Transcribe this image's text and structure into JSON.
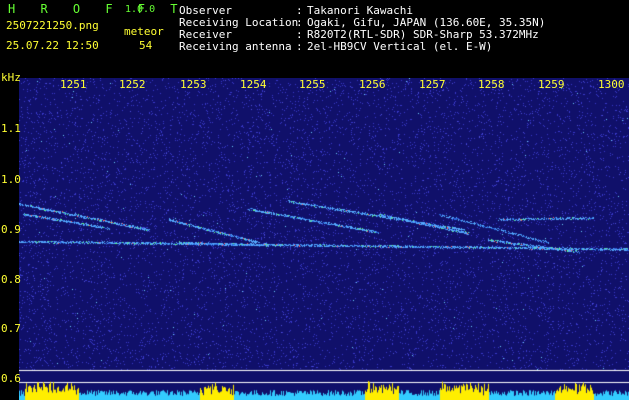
{
  "header": {
    "app_title": "H R O F F T",
    "version": "1.0.0",
    "filename": "2507221250.png",
    "datetime": "25.07.22 12:50",
    "count_label": "meteor",
    "count_value": "54",
    "fields": [
      {
        "label": "Observer",
        "sep": ":",
        "value": "Takanori Kawachi"
      },
      {
        "label": "Receiving Location",
        "sep": ":",
        "value": "Ogaki, Gifu, JAPAN (136.60E, 35.35N)"
      },
      {
        "label": "Receiver",
        "sep": ":",
        "value": "R820T2(RTL-SDR) SDR-Sharp 53.372MHz"
      },
      {
        "label": "Receiving antenna",
        "sep": ":",
        "value": "2el-HB9CV Vertical (el. E-W)"
      }
    ]
  },
  "spectrogram": {
    "unit_label": "kHz",
    "x_ticks": [
      "1251",
      "1252",
      "1253",
      "1254",
      "1255",
      "1256",
      "1257",
      "1258",
      "1259",
      "1300"
    ],
    "y_ticks": [
      "1.1",
      "1.0",
      "0.9",
      "0.8",
      "0.7",
      "0.6"
    ],
    "y_range": [
      0.575,
      1.2
    ],
    "colors": {
      "background": "#10106a",
      "noise": "#3a3acc",
      "echo": "#55aaff",
      "bar_cyan": "#33ccff",
      "bar_yellow": "#ffee00"
    }
  }
}
